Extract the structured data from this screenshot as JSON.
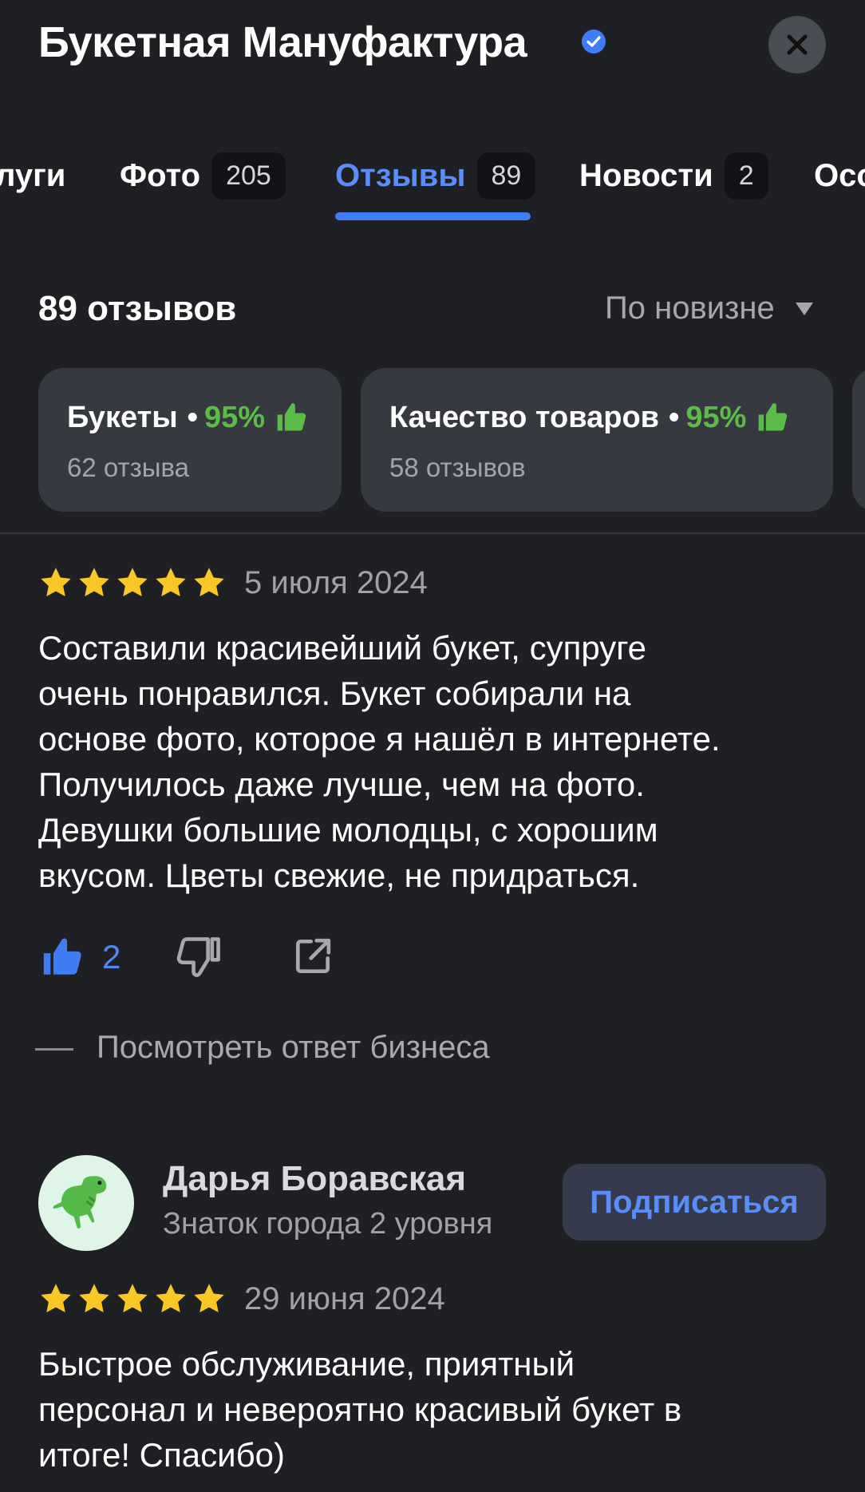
{
  "header": {
    "title": "Букетная Мануфактура",
    "verified_icon": "verified-badge-icon",
    "close_icon": "close-icon"
  },
  "tabs": [
    {
      "label": "луги",
      "count": null
    },
    {
      "label": "Фото",
      "count": "205"
    },
    {
      "label": "Отзывы",
      "count": "89",
      "active": true
    },
    {
      "label": "Новости",
      "count": "2"
    },
    {
      "label": "Осо",
      "count": null
    }
  ],
  "summary": {
    "reviews_count": "89 отзывов",
    "sort_label": "По новизне"
  },
  "aspects": [
    {
      "title": "Букеты",
      "separator": "•",
      "percent": "95%",
      "subtitle": "62 отзыва"
    },
    {
      "title": "Качество товаров",
      "separator": "•",
      "percent": "95%",
      "subtitle": "58 отзывов"
    }
  ],
  "reviews": [
    {
      "rating": 5,
      "date": "5 июля 2024",
      "lines": [
        "Составили  красивейший букет, супруге",
        "очень понравился.  Букет собирали на",
        "основе фото, которое я нашёл в интернете.",
        "Получилось даже лучше, чем на фото.",
        "Девушки большие молодцы, с хорошим",
        "вкусом. Цветы свежие,  не придраться."
      ],
      "likes": "2",
      "business_reply_link": "Посмотреть ответ бизнеса"
    },
    {
      "author": "Дарья Боравская",
      "author_level": "Знаток города 2 уровня",
      "subscribe_label": "Подписаться",
      "avatar_icon": "dinosaur-avatar-icon",
      "rating": 5,
      "date": "29 июня 2024",
      "lines": [
        "Быстрое обслуживание, приятный",
        "персонал и невероятно красивый букет в",
        "итоге! Спасибо)"
      ]
    }
  ],
  "colors": {
    "background": "#1f2024",
    "accent_blue": "#3f7cf6",
    "positive_green": "#5bbd48",
    "star_yellow": "#f9c824",
    "chip_bg": "#373940"
  }
}
